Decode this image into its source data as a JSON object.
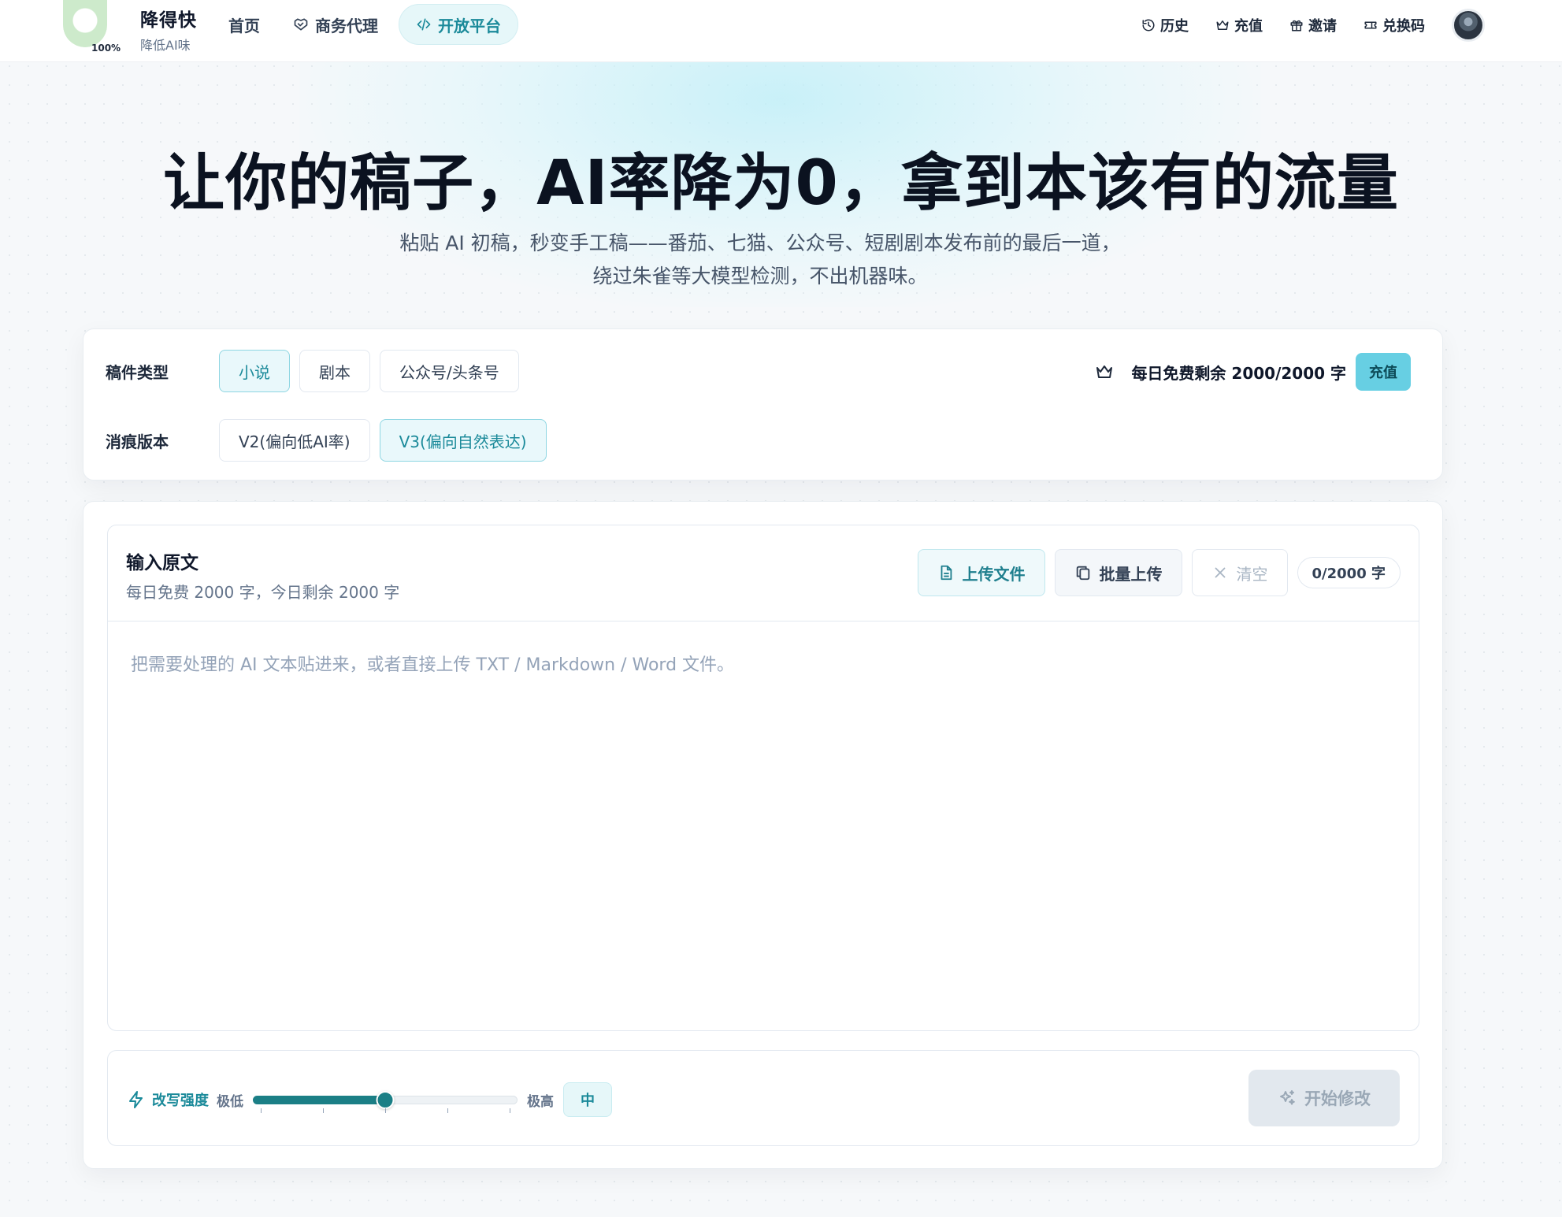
{
  "brand": {
    "name": "降得快",
    "sub": "降低AI味",
    "logo_percent": "100%"
  },
  "nav": [
    {
      "label": "首页",
      "icon": "none"
    },
    {
      "label": "商务代理",
      "icon": "handshake-icon"
    },
    {
      "label": "开放平台",
      "icon": "code-icon",
      "active": true
    }
  ],
  "top_links": [
    {
      "label": "历史",
      "icon": "history-icon"
    },
    {
      "label": "充值",
      "icon": "crown-icon"
    },
    {
      "label": "邀请",
      "icon": "gift-icon"
    },
    {
      "label": "兑换码",
      "icon": "ticket-icon"
    }
  ],
  "hero": {
    "title": "让你的稿子，AI率降为0，拿到本该有的流量",
    "sub_line1": "粘贴 AI 初稿，秒变手工稿——番茄、七猫、公众号、短剧剧本发布前的最后一道，",
    "sub_line2": "绕过朱雀等大模型检测，不出机器味。"
  },
  "options": {
    "type_label": "稿件类型",
    "types": [
      "小说",
      "剧本",
      "公众号/头条号"
    ],
    "selected_type": "小说",
    "version_label": "消痕版本",
    "versions": [
      "V2(偏向低AI率)",
      "V3(偏向自然表达)"
    ],
    "selected_version": "V3(偏向自然表达)",
    "quota_text": "每日免费剩余 2000/2000 字",
    "recharge_label": "充值"
  },
  "editor": {
    "title": "输入原文",
    "subtitle": "每日免费 2000 字，今日剩余 2000 字",
    "upload_label": "上传文件",
    "batch_label": "批量上传",
    "clear_label": "清空",
    "counter": "0/2000 字",
    "placeholder": "把需要处理的 AI 文本贴进来，或者直接上传 TXT / Markdown / Word 文件。",
    "value": ""
  },
  "controls": {
    "strength_label": "改写强度",
    "low_label": "极低",
    "high_label": "极高",
    "level": "中",
    "level_fraction": 0.5,
    "tick_count": 5,
    "start_label": "开始修改"
  },
  "colors": {
    "accent": "#1b8a9a",
    "slider": "#1b7f86",
    "recharge": "#67cfe3"
  }
}
